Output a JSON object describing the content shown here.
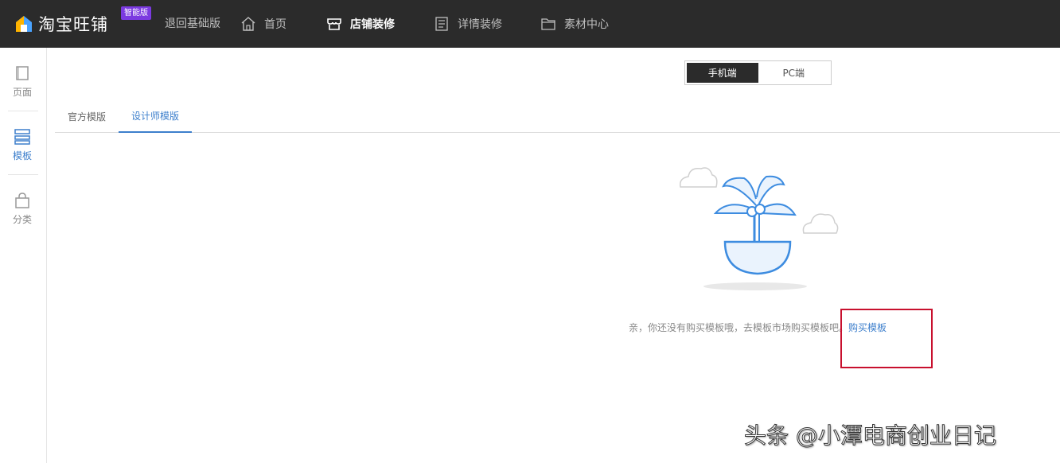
{
  "header": {
    "logo_text": "淘宝旺铺",
    "badge": "智能版",
    "back_label": "退回基础版",
    "nav": [
      {
        "label": "首页",
        "icon": "home-icon"
      },
      {
        "label": "店铺装修",
        "icon": "store-icon",
        "active": true
      },
      {
        "label": "详情装修",
        "icon": "document-icon"
      },
      {
        "label": "素材中心",
        "icon": "folder-icon"
      }
    ]
  },
  "sidebar": {
    "items": [
      {
        "label": "页面",
        "icon": "page-icon"
      },
      {
        "label": "模板",
        "icon": "template-icon",
        "active": true
      },
      {
        "label": "分类",
        "icon": "bag-icon"
      }
    ]
  },
  "device_toggle": {
    "mobile": "手机端",
    "pc": "PC端",
    "selected": "手机端"
  },
  "tabs": [
    {
      "label": "官方模版"
    },
    {
      "label": "设计师模版",
      "active": true
    }
  ],
  "empty_state": {
    "message": "亲，你还没有购买模板哦，去模板市场购买模板吧。",
    "link": "购买模板"
  },
  "watermark": "头条 @小潭电商创业日记",
  "colors": {
    "topbar": "#2b2b2b",
    "accent": "#3d7fcc",
    "badge": "#7b3ae0",
    "highlight": "#c8102e"
  }
}
